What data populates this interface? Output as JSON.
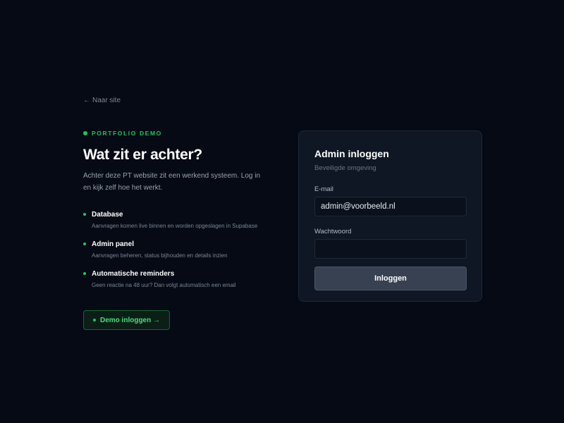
{
  "back_link": {
    "arrow": "←",
    "label": "Naar site"
  },
  "intro": {
    "eyebrow": "PORTFOLIO DEMO",
    "heading": "Wat zit er achter?",
    "text": "Achter deze PT website zit een werkend systeem. Log in en kijk zelf hoe het werkt."
  },
  "features": [
    {
      "title": "Database",
      "description": "Aanvragen komen live binnen en worden opgeslagen in Supabase"
    },
    {
      "title": "Admin panel",
      "description": "Aanvragen beheren, status bijhouden en details inzien"
    },
    {
      "title": "Automatische reminders",
      "description": "Geen reactie na 48 uur? Dan volgt automatisch een email"
    }
  ],
  "demo_button": {
    "label": "Demo inloggen →"
  },
  "login": {
    "title": "Admin inloggen",
    "subtitle": "Beveiligde omgeving",
    "email_label": "E-mail",
    "email_value": "admin@voorbeeld.nl",
    "password_label": "Wachtwoord",
    "password_value": "",
    "submit_label": "Inloggen"
  },
  "colors": {
    "background": "#050a14",
    "accent": "#22c55e",
    "card": "#0f1624",
    "button": "#384152"
  }
}
